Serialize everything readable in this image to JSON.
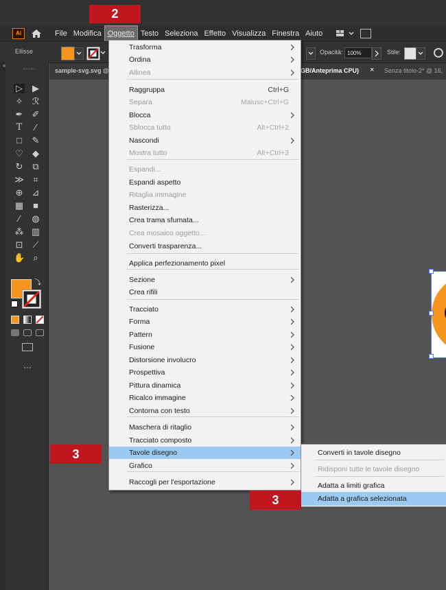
{
  "badges": {
    "top": "2",
    "left": "3",
    "bottom": "3"
  },
  "menubar": {
    "logo": "Ai",
    "items": [
      "File",
      "Modifica",
      "Oggetto",
      "Testo",
      "Seleziona",
      "Effetto",
      "Visualizza",
      "Finestra",
      "Aiuto"
    ]
  },
  "control": {
    "selection_label": "Ellisse",
    "opacity_label": "Opacità:",
    "opacity_value": "100%",
    "style_label": "Stile:",
    "fill_color": "#f7941d"
  },
  "tabs": {
    "first": "sample-svg.svg @",
    "middle_fragment": "GB/Anteprima CPU)",
    "close": "×",
    "second": "Senza titolo-2* @ 16,"
  },
  "menu": {
    "items": [
      {
        "label": "Trasforma",
        "submenu": true
      },
      {
        "label": "Ordina",
        "submenu": true
      },
      {
        "label": "Allinea",
        "submenu": true,
        "disabled": true
      },
      {
        "label": "Raggruppa",
        "shortcut": "Ctrl+G"
      },
      {
        "label": "Separa",
        "shortcut": "Maiusc+Ctrl+G",
        "disabled": true
      },
      {
        "label": "Blocca",
        "submenu": true
      },
      {
        "label": "Sblocca tutto",
        "shortcut": "Alt+Ctrl+2",
        "disabled": true
      },
      {
        "label": "Nascondi",
        "submenu": true
      },
      {
        "label": "Mostra tutto",
        "shortcut": "Alt+Ctrl+3",
        "disabled": true
      },
      {
        "label": "Espandi...",
        "disabled": true
      },
      {
        "label": "Espandi aspetto"
      },
      {
        "label": "Ritaglia immagine",
        "disabled": true
      },
      {
        "label": "Rasterizza..."
      },
      {
        "label": "Crea trama sfumata..."
      },
      {
        "label": "Crea mosaico oggetto...",
        "disabled": true
      },
      {
        "label": "Converti trasparenza..."
      },
      {
        "label": "Applica perfezionamento pixel"
      },
      {
        "label": "Sezione",
        "submenu": true
      },
      {
        "label": "Crea rifili"
      },
      {
        "label": "Tracciato",
        "submenu": true
      },
      {
        "label": "Forma",
        "submenu": true
      },
      {
        "label": "Pattern",
        "submenu": true
      },
      {
        "label": "Fusione",
        "submenu": true
      },
      {
        "label": "Distorsione involucro",
        "submenu": true
      },
      {
        "label": "Prospettiva",
        "submenu": true
      },
      {
        "label": "Pittura dinamica",
        "submenu": true
      },
      {
        "label": "Ricalco immagine",
        "submenu": true
      },
      {
        "label": "Contorna con testo",
        "submenu": true
      },
      {
        "label": "Maschera di ritaglio",
        "submenu": true
      },
      {
        "label": "Tracciato composto",
        "submenu": true
      },
      {
        "label": "Tavole disegno",
        "submenu": true,
        "highlighted": true
      },
      {
        "label": "Grafico",
        "submenu": true
      },
      {
        "label": "Raccogli per l'esportazione",
        "submenu": true
      }
    ]
  },
  "submenu": {
    "items": [
      {
        "label": "Converti in tavole disegno"
      },
      {
        "label": "Ridisponi tutte le tavole disegno",
        "disabled": true
      },
      {
        "label": "Adatta a limiti grafica"
      },
      {
        "label": "Adatta a grafica selezionata",
        "highlighted": true
      }
    ]
  },
  "toolbox": {
    "more": "···"
  }
}
